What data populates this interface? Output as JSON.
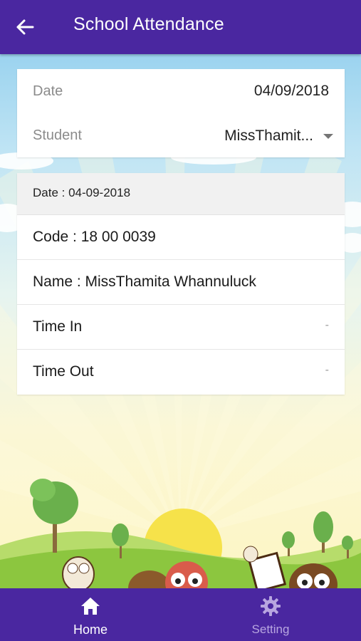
{
  "header": {
    "title": "School Attendance",
    "back_icon": "arrow-left-icon"
  },
  "filter": {
    "date_label": "Date",
    "date_value": "04/09/2018",
    "student_label": "Student",
    "student_value": "MissThamit..."
  },
  "attendance": {
    "date_line": "Date : 04-09-2018",
    "code_line": "Code : 18 00 0039",
    "name_line": "Name : MissThamita Whannuluck",
    "time_in_label": "Time In",
    "time_in_value": "-",
    "time_out_label": "Time Out",
    "time_out_value": "-"
  },
  "bottom_nav": {
    "items": [
      {
        "label": "Home",
        "icon": "home-icon",
        "active": true
      },
      {
        "label": "Setting",
        "icon": "gear-icon",
        "active": false
      }
    ]
  },
  "colors": {
    "primary": "#4a27a0",
    "inactive_nav": "#b8a6e0"
  }
}
